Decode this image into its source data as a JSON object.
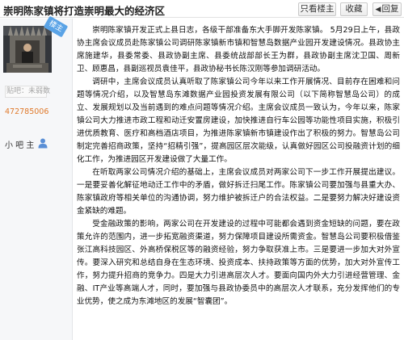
{
  "header": {
    "title": "崇明陈家镇将打造崇明最大的经济区",
    "only_op_label": "只看楼主",
    "favorite_label": "收藏",
    "reply_label": "回复"
  },
  "sidebar": {
    "badge": "楼主",
    "level_text": "贴吧：未弱数",
    "uid": "472785006",
    "role": "小 吧 主"
  },
  "post": {
    "paragraphs": [
      "崇明陈家镇开发正式上县日志，各级干部准备东大手脚开发陈家镇。 5月29日上午，县政协主席会议成员赴陈家镇公司调研陈家镇新市镇和智慧岛数据产业园开发建设情况。县政协主席施建华，县委常委、县政协副主席、县委统战部部长王为群，县政协副主席沈卫国、周新卫、顾惠昌，县副巡视员袁佳平，县政协秘书长陈汉刚等参加调研活动。",
      "调研中，主席会议成员认真听取了陈家镇公司今年以来工作开展情况、目前存在困难和问题等情况介绍，以及智慧岛东滩数据产业园投资发展有限公司（以下简称智慧岛公司）的成立、发展规划以及当前遇到的难点问题等情况介绍。主席会议成员一致认为，今年以来，陈家镇公司大力推进市政工程和动迁安置房建设，加快推进自行车公园等功能性项目实施，积极引进优质教育、医疗和高档酒店项目，为推进陈家镇新市镇建设作出了积极的努力。智慧岛公司制定完善招商政策，坚持“招精引强”，提高园区层次能级，认真做好园区公司投融资计划的细化工作，为推进园区开发建设做了大量工作。",
      "在听取两家公司情况介绍的基础上，主席会议成员对两家公司下一步工作开展提出建议。一是要妥善化解征地动迁工作中的矛盾，做好拆迁扫尾工作。陈家镇公司要加强与县重大办、陈家镇政府等相关单位的沟通协调，努力维护被拆迁户的合法权益。二是要努力解决好建设资金紧缺的难题。",
      "受金融政策的影响，两家公司在开发建设的过程中可能都会遇到资金短缺的问题，要在政策允许的范围内，进一步拓宽融资渠道，努力保障项目建设所需资金。智慧岛公司要积极借鉴张江高科技园区、外高桥保税区等的融资经验，努力争取获准上市。三是要进一步加大对外宣传。要深入研究和总结自身在生态环境、投资成本、扶持政策等方面的优势，加大对外宣传工作，努力提升招商的竞争力。四是大力引进高层次人才。要面向国内外大力引进经营管理、金融、IT产业等高端人才，同时，要加强与县政协委员中的高层次人才联系，充分发挥他们的专业优势，使之成为东滩地区的发展“智囊团”。"
    ]
  },
  "icons": {
    "avatar": "throne-avatar-image",
    "user": "user-person-icon",
    "back": "left-arrow-icon"
  }
}
